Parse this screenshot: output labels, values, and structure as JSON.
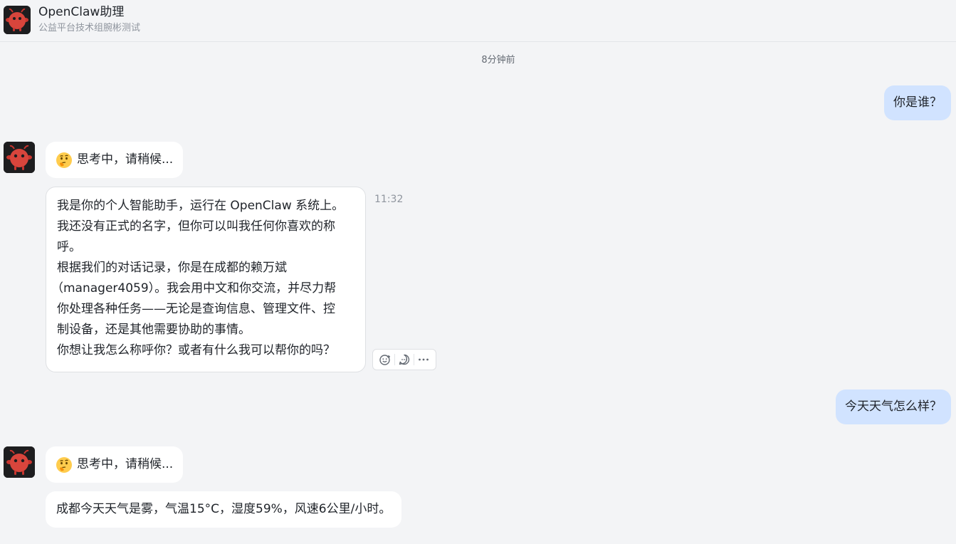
{
  "header": {
    "title": "OpenClaw助理",
    "subtitle": "公益平台技术组腕彬测试"
  },
  "chat": {
    "time_divider": "8分钟前",
    "messages": [
      {
        "role": "user",
        "text": "你是谁？"
      },
      {
        "role": "bot",
        "type": "thinking",
        "text": "思考中，请稍候..."
      },
      {
        "role": "bot",
        "type": "reply",
        "time": "11:32",
        "lines": [
          "我是你的个人智能助手，运行在 OpenClaw 系统上。",
          "我还没有正式的名字，但你可以叫我任何你喜欢的称",
          "呼。",
          "根据我们的对话记录，你是在成都的赖万斌",
          "（manager4059）。我会用中文和你交流，并尽力帮",
          "你处理各种任务——无论是查询信息、管理文件、控",
          "制设备，还是其他需要协助的事情。",
          "你想让我怎么称呼你？或者有什么我可以帮你的吗？"
        ]
      },
      {
        "role": "user",
        "text": "今天天气怎么样？"
      },
      {
        "role": "bot",
        "type": "thinking",
        "text": "思考中，请稍候..."
      },
      {
        "role": "bot",
        "type": "reply",
        "text": "成都今天天气是雾，气温15°C，湿度59%，风速6公里/小时。"
      }
    ]
  },
  "icons": {
    "avatar": "red-bug-mascot-icon",
    "thinking": "thinking-face-emoji",
    "reaction": "add-reaction-icon",
    "reply": "reply-comment-icon",
    "more": "more-horizontal-icon"
  },
  "colors": {
    "user_bubble": "#d1e3ff",
    "bot_bubble": "#ffffff",
    "background": "#f3f4f6"
  }
}
